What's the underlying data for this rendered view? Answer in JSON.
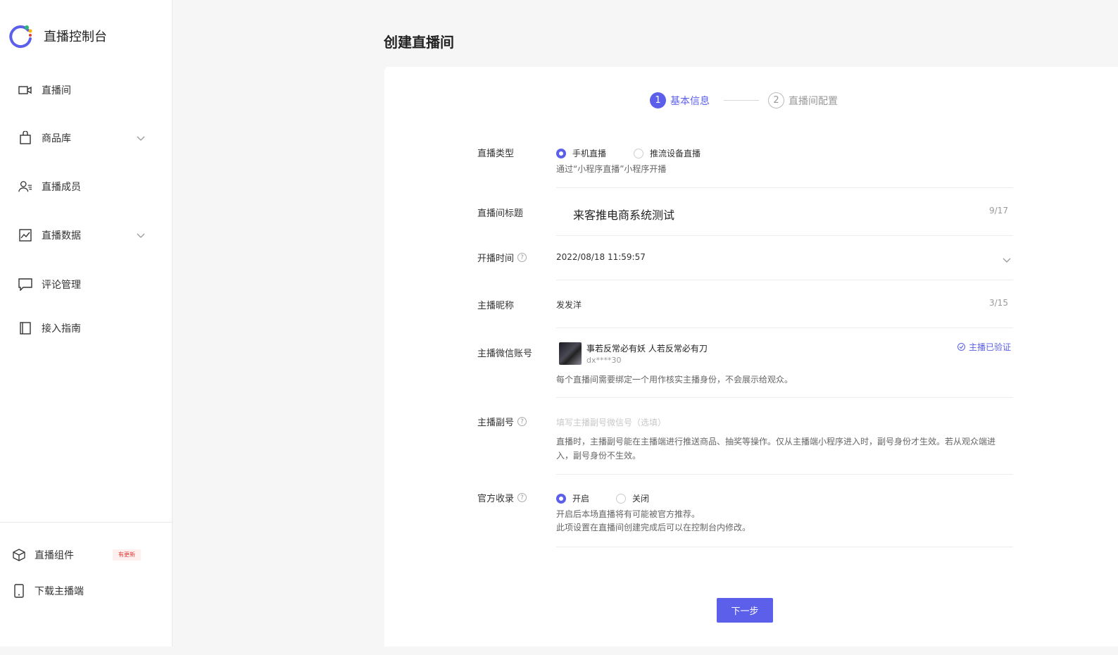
{
  "app": {
    "title": "直播控制台"
  },
  "colors": {
    "accent": "#5b5fea",
    "badge": "#e53935"
  },
  "sidebar": {
    "items": [
      {
        "label": "直播间",
        "icon": "video-camera-icon"
      },
      {
        "label": "商品库",
        "icon": "shopping-bag-icon"
      },
      {
        "label": "直播成员",
        "icon": "user-list-icon"
      },
      {
        "label": "直播数据",
        "icon": "chart-image-icon"
      },
      {
        "label": "评论管理",
        "icon": "comment-icon"
      },
      {
        "label": "接入指南",
        "icon": "book-icon"
      }
    ],
    "bottom": [
      {
        "label": "直播组件",
        "icon": "cube-icon",
        "badge": "有更新"
      },
      {
        "label": "下载主播端",
        "icon": "phone-icon"
      }
    ]
  },
  "page": {
    "title": "创建直播间"
  },
  "steps": [
    {
      "num": "1",
      "label": "基本信息"
    },
    {
      "num": "2",
      "label": "直播间配置"
    }
  ],
  "form": {
    "type": {
      "label": "直播类型",
      "options": [
        "手机直播",
        "推流设备直播"
      ],
      "hint": "通过“小程序直播”小程序开播"
    },
    "title": {
      "label": "直播间标题",
      "value": "来客推电商系统测试",
      "counter": "9/17"
    },
    "time": {
      "label": "开播时间",
      "value": "2022/08/18 11:59:57"
    },
    "nickname": {
      "label": "主播昵称",
      "value": "发发洋",
      "counter": "3/15"
    },
    "wechat": {
      "label": "主播微信账号",
      "name": "事若反常必有妖 人若反常必有刀",
      "id": "dx****30",
      "status": "主播已验证",
      "hint": "每个直播间需要绑定一个用作核实主播身份，不会展示给观众。"
    },
    "deputy": {
      "label": "主播副号",
      "placeholder": "填写主播副号微信号（选填）",
      "hint1": "直播时，主播副号能在主播端进行推送商品、抽奖等操作。仅从主播端小程序进入时，副号身份才生效。若从观众端进",
      "hint2": "入，副号身份不生效。"
    },
    "official": {
      "label": "官方收录",
      "options": [
        "开启",
        "关闭"
      ],
      "hint1": "开启后本场直播将有可能被官方推荐。",
      "hint2": "此项设置在直播间创建完成后可以在控制台内修改。"
    }
  },
  "next_label": "下一步"
}
